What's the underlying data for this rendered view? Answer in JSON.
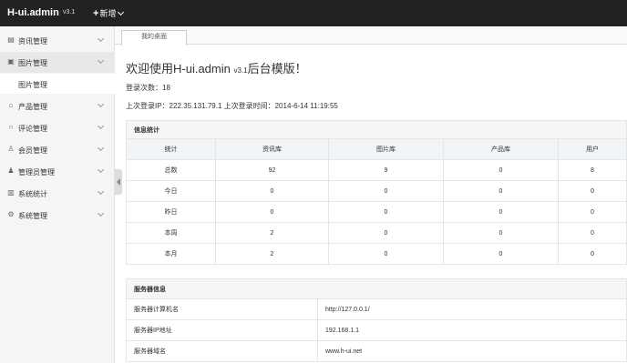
{
  "header": {
    "logo": "H-ui.admin",
    "version": "v3.1",
    "new_label": "新增"
  },
  "sidebar": {
    "items": [
      {
        "label": "资讯管理",
        "icon": "news-icon"
      },
      {
        "label": "图片管理",
        "icon": "image-icon"
      },
      {
        "label": "产品管理",
        "icon": "product-icon"
      },
      {
        "label": "评论管理",
        "icon": "comment-icon"
      },
      {
        "label": "会员管理",
        "icon": "member-icon"
      },
      {
        "label": "管理员管理",
        "icon": "admin-icon"
      },
      {
        "label": "系统统计",
        "icon": "stats-icon"
      },
      {
        "label": "系统管理",
        "icon": "settings-icon"
      }
    ],
    "submenu": {
      "label": "图片管理"
    }
  },
  "tabs": [
    {
      "label": "我的桌面"
    }
  ],
  "main": {
    "welcome": "欢迎使用H-ui.admin",
    "welcome_version": "v3.1",
    "welcome_suffix": "后台模版！",
    "login_count": "登录次数：18",
    "last_login": "上次登录IP：222.35.131.79.1  上次登录时间：2014-6-14 11:19:55"
  },
  "stats_table": {
    "caption": "信息统计",
    "headers": [
      "统计",
      "资讯库",
      "图片库",
      "产品库",
      "用户"
    ],
    "rows": [
      [
        "总数",
        "92",
        "9",
        "0",
        "8"
      ],
      [
        "今日",
        "0",
        "0",
        "0",
        "0"
      ],
      [
        "昨日",
        "0",
        "0",
        "0",
        "0"
      ],
      [
        "本周",
        "2",
        "0",
        "0",
        "0"
      ],
      [
        "本月",
        "2",
        "0",
        "0",
        "0"
      ]
    ]
  },
  "server_table": {
    "caption": "服务器信息",
    "rows": [
      [
        "服务器计算机名",
        "http://127.0.0.1/"
      ],
      [
        "服务器IP地址",
        "192.168.1.1"
      ],
      [
        "服务器域名",
        "www.h-ui.net"
      ]
    ]
  }
}
